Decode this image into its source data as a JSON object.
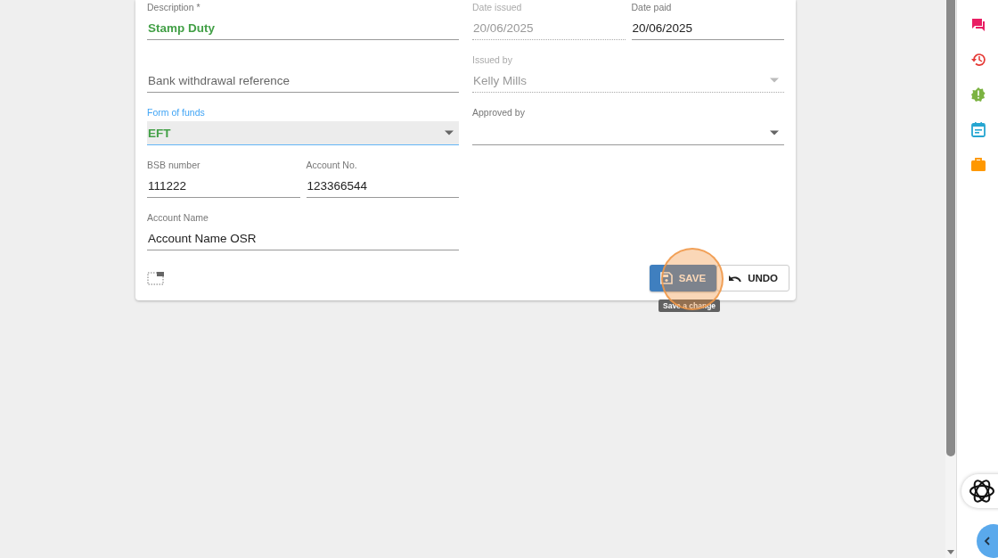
{
  "form": {
    "rows": [
      {
        "left": [
          {
            "kind": "text",
            "label": "Description *",
            "value": "Stamp Duty",
            "emphasis": true,
            "disabled": false,
            "focused": false
          }
        ],
        "right": [
          {
            "kind": "text",
            "label": "Date issued",
            "value": "20/06/2025",
            "emphasis": false,
            "disabled": true,
            "focused": false
          },
          {
            "kind": "text",
            "label": "Date paid",
            "value": "20/06/2025",
            "emphasis": false,
            "disabled": false,
            "focused": false
          }
        ]
      },
      {
        "left": [
          {
            "kind": "text",
            "placeholder": "Bank withdrawal reference",
            "disabled": false,
            "focused": false
          }
        ],
        "right": [
          {
            "kind": "select",
            "label": "Issued by",
            "value": "Kelly Mills",
            "emphasis": false,
            "disabled": true,
            "focused": false
          }
        ]
      },
      {
        "left": [
          {
            "kind": "select",
            "label": "Form of funds",
            "value": "EFT",
            "emphasis": true,
            "disabled": false,
            "focused": true
          }
        ],
        "right": [
          {
            "kind": "select",
            "label": "Approved by",
            "disabled": false,
            "focused": false
          }
        ]
      },
      {
        "left": [
          {
            "kind": "text",
            "label": "BSB number",
            "value": "111222",
            "emphasis": false,
            "disabled": false,
            "focused": false
          },
          {
            "kind": "text",
            "label": "Account No.",
            "value": "123366544",
            "emphasis": false,
            "disabled": false,
            "focused": false
          }
        ]
      },
      {
        "left": [
          {
            "kind": "text",
            "label": "Account Name",
            "value": "Account Name OSR",
            "emphasis": false,
            "disabled": false,
            "focused": false
          }
        ]
      }
    ],
    "buttons": [
      {
        "kind": "primary",
        "label": "SAVE"
      },
      {
        "kind": "outlined",
        "label": "UNDO"
      }
    ],
    "tooltip": "Save a change"
  },
  "sidebar": {
    "icons": [
      {
        "kind": "chat",
        "color": "#e91e63"
      },
      {
        "kind": "history",
        "color": "#e53935"
      },
      {
        "kind": "alert",
        "color": "#7cb342"
      },
      {
        "kind": "calendar",
        "color": "#26a6d1"
      },
      {
        "kind": "briefcase",
        "color": "#ff9800"
      }
    ]
  }
}
